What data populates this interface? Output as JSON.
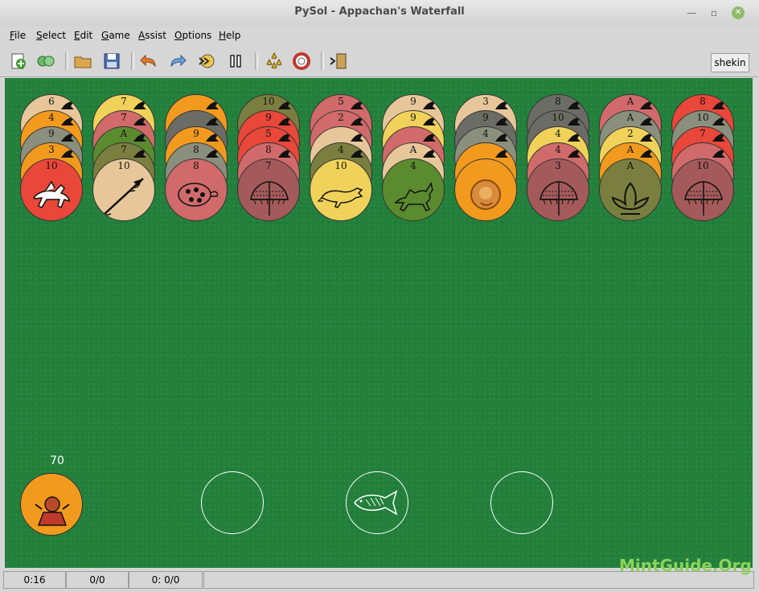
{
  "window": {
    "title": "PySol - Appachan's Waterfall"
  },
  "menu": [
    {
      "label": "File",
      "ul": "F",
      "rest": "ile"
    },
    {
      "label": "Select",
      "ul": "S",
      "rest": "elect"
    },
    {
      "label": "Edit",
      "ul": "E",
      "rest": "dit"
    },
    {
      "label": "Game",
      "ul": "G",
      "rest": "ame"
    },
    {
      "label": "Assist",
      "ul": "A",
      "rest": "ssist"
    },
    {
      "label": "Options",
      "ul": "O",
      "rest": "ptions"
    },
    {
      "label": "Help",
      "ul": "H",
      "rest": "elp"
    }
  ],
  "toolbar": {
    "player": "shekin",
    "buttons": [
      "new-game-icon",
      "restart-icon",
      "open-icon",
      "save-icon",
      "undo-icon",
      "redo-icon",
      "autodrop-icon",
      "pause-icon",
      "statistics-icon",
      "rules-icon",
      "quit-icon"
    ]
  },
  "colors": {
    "tan": "#e7c79a",
    "orange": "#f29a1e",
    "gray": "#8b8f7d",
    "red": "#e8473a",
    "yellow": "#f0d25a",
    "pink": "#d16a6a",
    "olive": "#7a7e3f",
    "green": "#5b8b2f",
    "mauve": "#a45a5a",
    "darkgray": "#6c6c66",
    "felt": "#22803b"
  },
  "tableau": [
    {
      "cards": [
        {
          "rank": "6",
          "color": "tan",
          "icon": "bird-icon"
        },
        {
          "rank": "4",
          "color": "orange",
          "icon": "bird-icon"
        },
        {
          "rank": "9",
          "color": "gray",
          "icon": "bird-icon"
        },
        {
          "rank": "3",
          "color": "orange",
          "icon": "bird-icon"
        },
        {
          "rank": "10",
          "color": "red",
          "icon": "winged-horse-icon",
          "face": true
        }
      ]
    },
    {
      "cards": [
        {
          "rank": "7",
          "color": "yellow",
          "icon": "arrow-icon"
        },
        {
          "rank": "7",
          "color": "pink",
          "icon": "arrow-icon"
        },
        {
          "rank": "A",
          "color": "green",
          "icon": "arrow-icon"
        },
        {
          "rank": "7",
          "color": "olive",
          "icon": "arrow-icon"
        },
        {
          "rank": "10",
          "color": "tan",
          "icon": "arrow-icon",
          "face": true
        }
      ]
    },
    {
      "cards": [
        {
          "rank": "",
          "color": "orange",
          "icon": "deity-icon"
        },
        {
          "rank": "",
          "color": "darkgray",
          "icon": "deity-icon"
        },
        {
          "rank": "9",
          "color": "orange",
          "icon": "turtle-icon"
        },
        {
          "rank": "8",
          "color": "gray",
          "icon": "turtle-icon"
        },
        {
          "rank": "8",
          "color": "pink",
          "icon": "turtle-icon",
          "face": true
        }
      ]
    },
    {
      "cards": [
        {
          "rank": "10",
          "color": "olive",
          "icon": "umbrella-icon"
        },
        {
          "rank": "9",
          "color": "red",
          "icon": "umbrella-icon"
        },
        {
          "rank": "5",
          "color": "red",
          "icon": "umbrella-icon"
        },
        {
          "rank": "8",
          "color": "pink",
          "icon": "umbrella-icon"
        },
        {
          "rank": "7",
          "color": "mauve",
          "icon": "umbrella-icon",
          "face": true
        }
      ]
    },
    {
      "cards": [
        {
          "rank": "5",
          "color": "pink",
          "icon": "rat-icon"
        },
        {
          "rank": "2",
          "color": "pink",
          "icon": "rat-icon"
        },
        {
          "rank": "",
          "color": "tan",
          "icon": "rat-icon"
        },
        {
          "rank": "4",
          "color": "olive",
          "icon": "rat-icon"
        },
        {
          "rank": "10",
          "color": "yellow",
          "icon": "rat-icon",
          "face": true
        }
      ]
    },
    {
      "cards": [
        {
          "rank": "9",
          "color": "tan",
          "icon": "fox-icon"
        },
        {
          "rank": "9",
          "color": "yellow",
          "icon": "fox-icon"
        },
        {
          "rank": "",
          "color": "pink",
          "icon": "fox-icon"
        },
        {
          "rank": "A",
          "color": "tan",
          "icon": "fox-icon"
        },
        {
          "rank": "4",
          "color": "green",
          "icon": "fox-icon",
          "face": true
        }
      ]
    },
    {
      "cards": [
        {
          "rank": "3",
          "color": "tan",
          "icon": "lion-icon"
        },
        {
          "rank": "9",
          "color": "darkgray",
          "icon": "lion-icon"
        },
        {
          "rank": "4",
          "color": "gray",
          "icon": "lion-icon"
        },
        {
          "rank": "",
          "color": "orange",
          "icon": "lion-icon"
        },
        {
          "rank": "",
          "color": "orange",
          "icon": "lion-icon",
          "face": true
        }
      ]
    },
    {
      "cards": [
        {
          "rank": "8",
          "color": "darkgray",
          "icon": "umbrella-icon"
        },
        {
          "rank": "10",
          "color": "darkgray",
          "icon": "umbrella-icon"
        },
        {
          "rank": "4",
          "color": "yellow",
          "icon": "umbrella-icon"
        },
        {
          "rank": "4",
          "color": "pink",
          "icon": "umbrella-icon"
        },
        {
          "rank": "3",
          "color": "mauve",
          "icon": "umbrella-icon",
          "face": true
        }
      ]
    },
    {
      "cards": [
        {
          "rank": "A",
          "color": "pink",
          "icon": "lotus-icon"
        },
        {
          "rank": "A",
          "color": "gray",
          "icon": "lotus-icon"
        },
        {
          "rank": "2",
          "color": "yellow",
          "icon": "lotus-icon"
        },
        {
          "rank": "A",
          "color": "orange",
          "icon": "lotus-icon"
        },
        {
          "rank": "A",
          "color": "olive",
          "icon": "lotus-icon",
          "face": true
        }
      ]
    },
    {
      "cards": [
        {
          "rank": "8",
          "color": "red",
          "icon": "umbrella-icon"
        },
        {
          "rank": "10",
          "color": "gray",
          "icon": "umbrella-icon"
        },
        {
          "rank": "7",
          "color": "red",
          "icon": "umbrella-icon"
        },
        {
          "rank": "",
          "color": "pink",
          "icon": "umbrella-icon"
        },
        {
          "rank": "10",
          "color": "mauve",
          "icon": "umbrella-icon",
          "face": true
        }
      ]
    }
  ],
  "stock": {
    "count": "70",
    "icon": "deity-icon",
    "color": "orange"
  },
  "foundations": [
    {
      "name": "foundation-1",
      "empty": true
    },
    {
      "name": "foundation-2",
      "empty": true,
      "icon": "fish-icon"
    },
    {
      "name": "foundation-3",
      "empty": true
    }
  ],
  "status": {
    "time": "0:16",
    "moves": "0/0",
    "score": "0: 0/0"
  },
  "watermark": "MintGuide.Org"
}
